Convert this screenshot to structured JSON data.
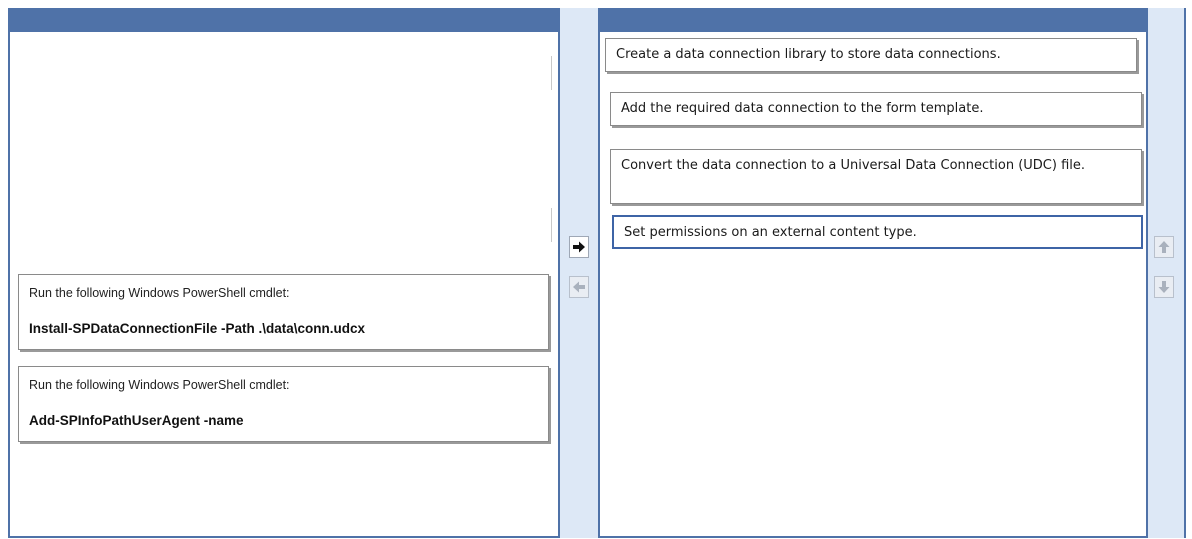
{
  "left_panel": {
    "items": [
      {
        "intro": "Run the following Windows PowerShell cmdlet:",
        "command": "Install-SPDataConnectionFile -Path .\\data\\conn.udcx"
      },
      {
        "intro": "Run the following Windows PowerShell cmdlet:",
        "command": "Add-SPInfoPathUserAgent -name"
      }
    ]
  },
  "right_panel": {
    "items": [
      {
        "text": "Create a data connection library to store data connections."
      },
      {
        "text": "Add the required data connection to the form template."
      },
      {
        "text": "Convert the data connection to a Universal Data Connection (UDC) file."
      },
      {
        "text": "Set permissions on an external content type."
      }
    ],
    "selected_index": 3
  },
  "controls": {
    "move_right": "arrow-right-icon",
    "move_left": "arrow-left-icon",
    "move_up": "arrow-up-icon",
    "move_down": "arrow-down-icon"
  },
  "colors": {
    "header": "#4f72a8",
    "gutter": "#dde8f6",
    "selected_border": "#3e64a6"
  }
}
